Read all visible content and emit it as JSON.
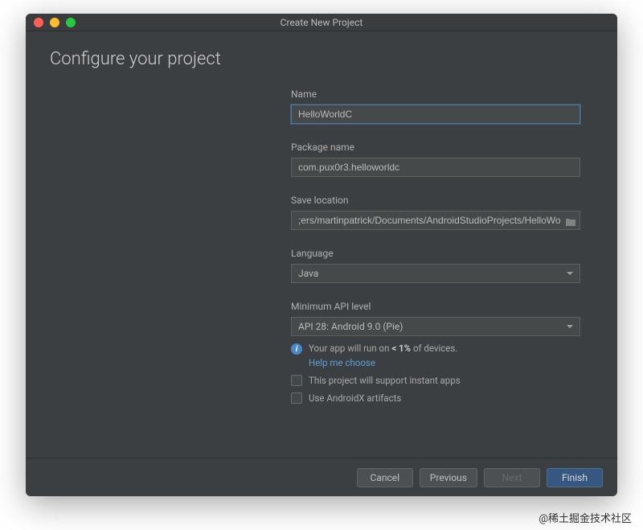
{
  "window": {
    "title": "Create New Project"
  },
  "page": {
    "title": "Configure your project"
  },
  "fields": {
    "name": {
      "label": "Name",
      "value": "HelloWorldC"
    },
    "package": {
      "label": "Package name",
      "value": "com.pux0r3.helloworldc"
    },
    "save": {
      "label": "Save location",
      "value": ";ers/martinpatrick/Documents/AndroidStudioProjects/HelloWorldC"
    },
    "language": {
      "label": "Language",
      "value": "Java"
    },
    "api": {
      "label": "Minimum API level",
      "value": "API 28: Android 9.0 (Pie)"
    }
  },
  "info": {
    "prefix": "Your app will run on ",
    "bold": "< 1%",
    "suffix": " of devices.",
    "help": "Help me choose"
  },
  "checkboxes": {
    "instant": "This project will support instant apps",
    "androidx": "Use AndroidX artifacts"
  },
  "buttons": {
    "cancel": "Cancel",
    "previous": "Previous",
    "next": "Next",
    "finish": "Finish"
  },
  "watermark": "@稀土掘金技术社区"
}
